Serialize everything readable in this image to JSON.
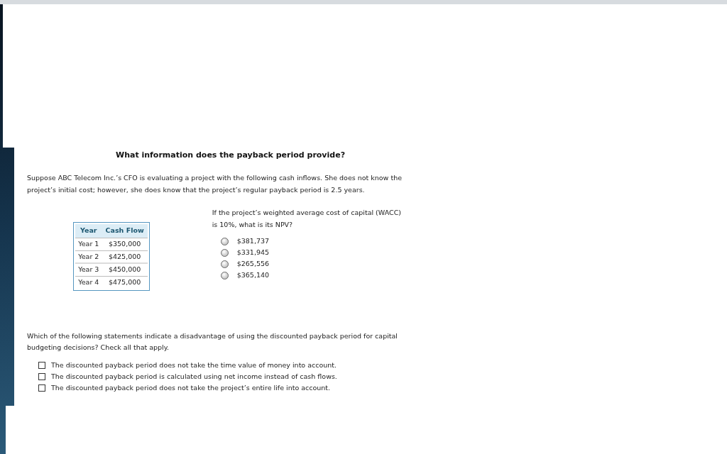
{
  "question_1": {
    "title": "What information does the payback period provide?",
    "scenario": "Suppose ABC Telecom Inc.’s CFO is evaluating a project with the following cash inflows. She does not know the project’s initial cost; however, she does know that the project’s regular payback period is 2.5 years.",
    "table": {
      "columns": [
        "Year",
        "Cash Flow"
      ],
      "rows": [
        [
          "Year 1",
          "$350,000"
        ],
        [
          "Year 2",
          "$425,000"
        ],
        [
          "Year 3",
          "$450,000"
        ],
        [
          "Year 4",
          "$475,000"
        ]
      ]
    },
    "prompt": "If the project’s weighted average cost of capital (WACC) is 10%, what is its NPV?",
    "options": [
      {
        "label": "$381,737",
        "selected": false
      },
      {
        "label": "$331,945",
        "selected": false
      },
      {
        "label": "$265,556",
        "selected": false
      },
      {
        "label": "$365,140",
        "selected": false
      }
    ]
  },
  "question_2": {
    "prompt": "Which of the following statements indicate a disadvantage of using the discounted payback period for capital budgeting decisions? Check all that apply.",
    "options": [
      {
        "label": "The discounted payback period does not take the time value of money into account.",
        "checked": false
      },
      {
        "label": "The discounted payback period is calculated using net income instead of cash flows.",
        "checked": false
      },
      {
        "label": "The discounted payback period does not take the project’s entire life into account.",
        "checked": false
      }
    ]
  }
}
